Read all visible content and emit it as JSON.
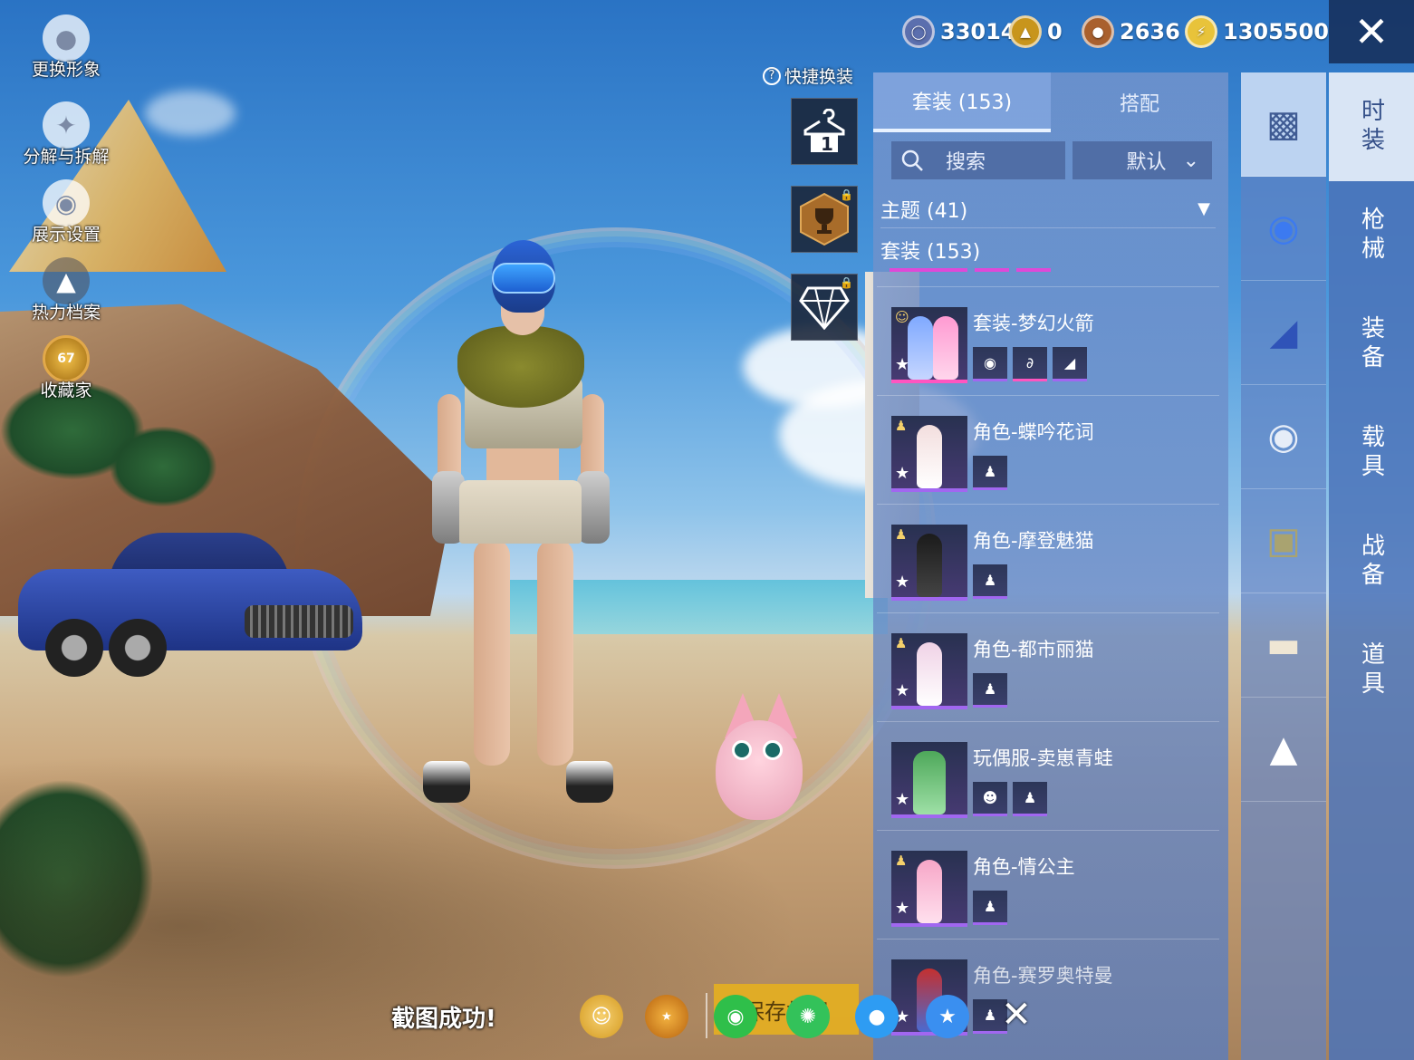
{
  "left_menu": [
    {
      "label": "更换形象",
      "icon": "avatar-icon"
    },
    {
      "label": "分解与拆解",
      "icon": "puzzle-icon"
    },
    {
      "label": "展示设置",
      "icon": "eye-icon"
    },
    {
      "label": "热力档案",
      "icon": "flame-icon"
    },
    {
      "label": "收藏家",
      "icon": "collector-badge-icon",
      "badge": "67"
    }
  ],
  "quick_change": {
    "label": "快捷换装",
    "slot1_number": "1"
  },
  "currencies": [
    {
      "value": "33014",
      "icon": "coin-silver-icon",
      "color": "#5b6fae"
    },
    {
      "value": "0",
      "icon": "coin-gold-icon",
      "color": "#c8951c"
    },
    {
      "value": "2636",
      "icon": "coin-bronze-icon",
      "color": "#a9602e"
    },
    {
      "value": "1305500",
      "icon": "coin-lightning-icon",
      "color": "#e8c33a"
    }
  ],
  "panel": {
    "tabs": [
      "套装 (153)",
      "搭配"
    ],
    "active_tab": 0,
    "search_label": "搜索",
    "sort_label": "默认",
    "filter_label": "主题 (41)",
    "category_label": "套装 (153)",
    "items": [
      {
        "name": "套装-梦幻火箭",
        "rarity": "pink",
        "subs": 3
      },
      {
        "name": "角色-蝶吟花词",
        "rarity": "purple",
        "subs": 1
      },
      {
        "name": "角色-摩登魅猫",
        "rarity": "purple",
        "subs": 1
      },
      {
        "name": "角色-都市丽猫",
        "rarity": "purple",
        "subs": 1
      },
      {
        "name": "玩偶服-卖崽青蛙",
        "rarity": "purple",
        "subs": 2
      },
      {
        "name": "角色-情公主",
        "rarity": "purple",
        "subs": 1
      },
      {
        "name": "角色-赛罗奥特曼",
        "rarity": "purple",
        "subs": 1
      }
    ]
  },
  "side_nav": [
    {
      "label": "时装",
      "active": true
    },
    {
      "label": "枪械",
      "active": false
    },
    {
      "label": "装备",
      "active": false
    },
    {
      "label": "载具",
      "active": false
    },
    {
      "label": "战备",
      "active": false
    },
    {
      "label": "道具",
      "active": false
    }
  ],
  "category_icons": [
    "fashion-box-icon",
    "helmet-icon",
    "goggles-icon",
    "mask-icon",
    "vest-icon",
    "shorts-icon",
    "shoes-icon"
  ],
  "bottom": {
    "toast": "截图成功!",
    "save_label": "保存相册"
  }
}
